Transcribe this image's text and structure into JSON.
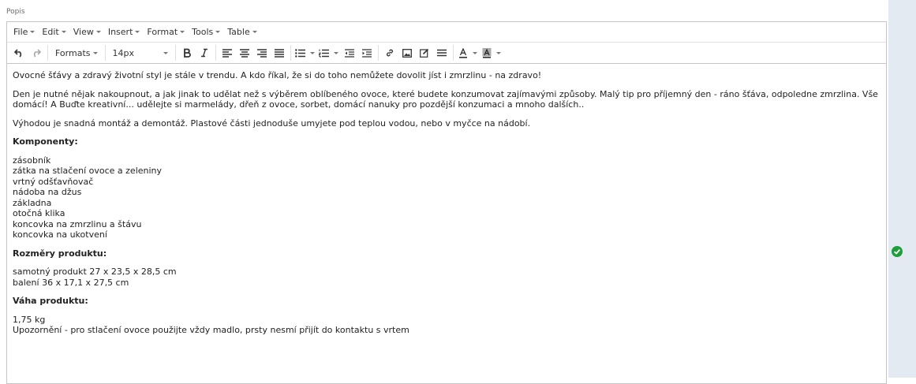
{
  "field": {
    "label": "Popis"
  },
  "menubar": {
    "items": [
      {
        "label": "File"
      },
      {
        "label": "Edit"
      },
      {
        "label": "View"
      },
      {
        "label": "Insert"
      },
      {
        "label": "Format"
      },
      {
        "label": "Tools"
      },
      {
        "label": "Table"
      }
    ]
  },
  "toolbar": {
    "formats_label": "Formats",
    "font_size_value": "14px",
    "icons": [
      "undo-icon",
      "redo-icon",
      "bold-icon",
      "italic-icon",
      "align-left-icon",
      "align-center-icon",
      "align-right-icon",
      "align-justify-icon",
      "bullet-list-icon",
      "numbered-list-icon",
      "outdent-icon",
      "indent-icon",
      "link-icon",
      "image-icon",
      "edit-icon",
      "horizontal-rule-icon",
      "text-color-icon",
      "background-color-icon"
    ]
  },
  "content": {
    "p1": "Ovocné šťávy a zdravý životní styl je stále v trendu. A kdo říkal, že si do toho nemůžete dovolit jíst i zmrzlinu - na zdravo!",
    "p2": "Den je nutné nějak nakoupnout, a jak jinak to udělat než s výběrem oblíbeného ovoce, které budete konzumovat zajímavými způsoby. Malý tip pro příjemný den - ráno šťáva, odpoledne zmrzlina. Vše domácí! A Buďte kreativní... udělejte si marmelády, dřeň z ovoce, sorbet, domácí nanuky pro pozdější konzumaci a mnoho dalších..",
    "p3": "Výhodou je snadná montáž a demontáž. Plastové části jednoduše umyjete pod teplou vodou, nebo v myčce na nádobí.",
    "h_components": "Komponenty:",
    "components": [
      "zásobník",
      "zátka na stlačení ovoce a zeleniny",
      "vrtný odšťavňovač",
      "nádoba na džus",
      "základna",
      "otočná klika",
      "koncovka na zmrzlinu a štávu",
      "koncovka na ukotvení"
    ],
    "h_dimensions": "Rozměry produktu:",
    "dimensions": [
      "samotný produkt 27 x 23,5 x 28,5 cm",
      "balení 36 x 17,1 x 27,5 cm"
    ],
    "h_weight": "Váha produktu:",
    "weight": [
      "1,75 kg",
      "Upozornění - pro stlačení ovoce použijte vždy madlo, prsty nesmí přijít do kontaktu s vrtem"
    ]
  },
  "colors": {
    "valid_check": "#1e9e3a",
    "panel_bg": "#e3eaf1"
  },
  "status": {
    "icon": "check-circle-icon"
  }
}
